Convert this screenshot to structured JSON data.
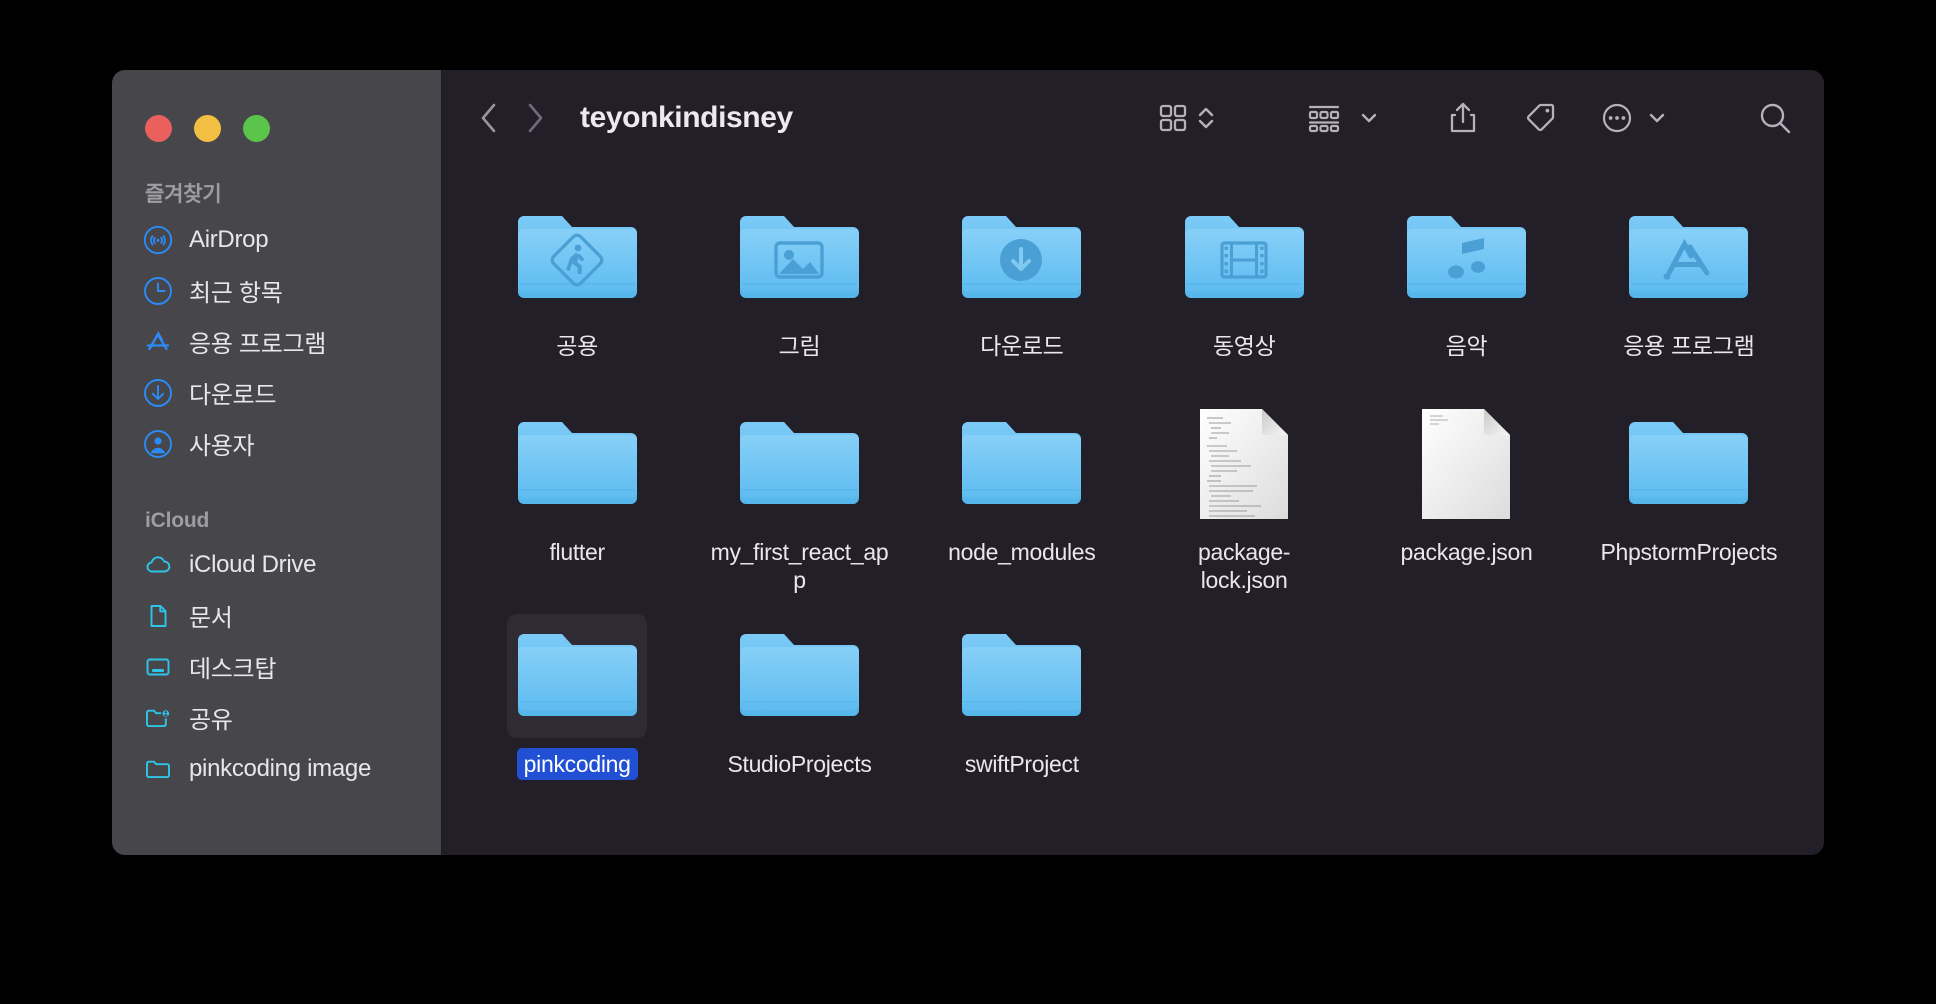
{
  "window": {
    "traffic_lights": [
      {
        "name": "close",
        "color": "#e9605c"
      },
      {
        "name": "minimize",
        "color": "#f2bf43"
      },
      {
        "name": "maximize",
        "color": "#5bc44b"
      }
    ],
    "sidebar_bg": "#47464a",
    "content_bg": "#231f29",
    "selection_color": "#2150d4"
  },
  "toolbar": {
    "back_label": "뒤로",
    "forward_label": "앞으로",
    "title": "teyonkindisney",
    "icons": [
      {
        "name": "icon-view-icon",
        "label": "아이콘 보기"
      },
      {
        "name": "chevron-up-down-icon",
        "label": "보기 옵션"
      },
      {
        "name": "group-by-icon",
        "label": "그룹으로 보기"
      },
      {
        "name": "chevron-down-icon",
        "label": "정렬"
      },
      {
        "name": "share-icon",
        "label": "공유"
      },
      {
        "name": "tag-icon",
        "label": "태그"
      },
      {
        "name": "more-ellipsis-icon",
        "label": "추가 옵션"
      },
      {
        "name": "chevron-down-icon",
        "label": "더보기"
      },
      {
        "name": "search-icon",
        "label": "검색"
      }
    ]
  },
  "sidebar": {
    "sections": [
      {
        "title": "즐겨찾기",
        "items": [
          {
            "label": "AirDrop",
            "icon": "airdrop-icon",
            "color": "#2b8cf7"
          },
          {
            "label": "최근 항목",
            "icon": "clock-icon",
            "color": "#2b8cf7"
          },
          {
            "label": "응용 프로그램",
            "icon": "app-store-icon",
            "color": "#2b8cf7"
          },
          {
            "label": "다운로드",
            "icon": "download-circle-icon",
            "color": "#2b8cf7"
          },
          {
            "label": "사용자",
            "icon": "user-circle-icon",
            "color": "#2b8cf7"
          }
        ]
      },
      {
        "title": "iCloud",
        "items": [
          {
            "label": "iCloud Drive",
            "icon": "cloud-icon",
            "color": "#2ec6e8"
          },
          {
            "label": "문서",
            "icon": "document-icon",
            "color": "#2ec6e8"
          },
          {
            "label": "데스크탑",
            "icon": "desktop-icon",
            "color": "#2ec6e8"
          },
          {
            "label": "공유",
            "icon": "shared-folder-icon",
            "color": "#2ec6e8"
          },
          {
            "label": "pinkcoding image",
            "icon": "folder-outline-icon",
            "color": "#2ec6e8"
          }
        ]
      }
    ]
  },
  "files": [
    {
      "name": "공용",
      "kind": "folder",
      "badge": "pedestrian",
      "selected": false
    },
    {
      "name": "그림",
      "kind": "folder",
      "badge": "picture",
      "selected": false
    },
    {
      "name": "다운로드",
      "kind": "folder",
      "badge": "download",
      "selected": false
    },
    {
      "name": "동영상",
      "kind": "folder",
      "badge": "film",
      "selected": false
    },
    {
      "name": "음악",
      "kind": "folder",
      "badge": "music",
      "selected": false
    },
    {
      "name": "응용 프로그램",
      "kind": "folder",
      "badge": "appstore",
      "selected": false
    },
    {
      "name": "flutter",
      "kind": "folder",
      "badge": "",
      "selected": false
    },
    {
      "name": "my_first_react_app",
      "kind": "folder",
      "badge": "",
      "selected": false
    },
    {
      "name": "node_modules",
      "kind": "folder",
      "badge": "",
      "selected": false
    },
    {
      "name": "package-lock.json",
      "kind": "file",
      "badge": "text",
      "selected": false
    },
    {
      "name": "package.json",
      "kind": "file",
      "badge": "blank",
      "selected": false
    },
    {
      "name": "PhpstormProjects",
      "kind": "folder",
      "badge": "",
      "selected": false
    },
    {
      "name": "pinkcoding",
      "kind": "folder",
      "badge": "",
      "selected": true
    },
    {
      "name": "StudioProjects",
      "kind": "folder",
      "badge": "",
      "selected": false
    },
    {
      "name": "swiftProject",
      "kind": "folder",
      "badge": "",
      "selected": false
    }
  ]
}
